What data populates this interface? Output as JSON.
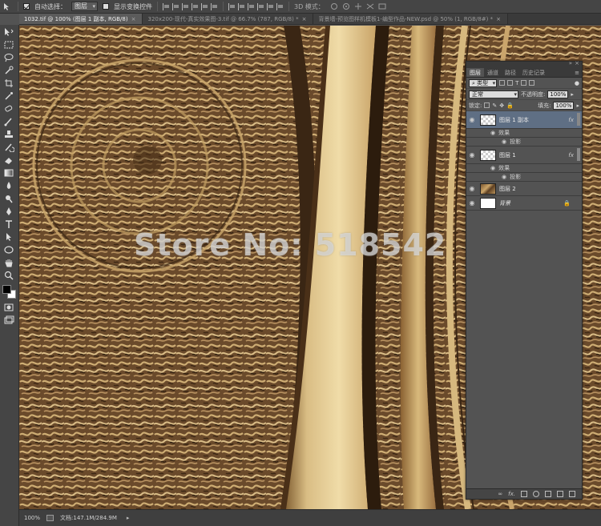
{
  "options_bar": {
    "auto_select_label": "自动选择：",
    "auto_select_value": "图层",
    "show_transform_label": "显示变换控件",
    "mode_3d_label": "3D 模式："
  },
  "tabs": [
    {
      "label": "1032.tif @ 100% (图层 1 副本, RGB/8)",
      "close": "×"
    },
    {
      "label": "320x200-现代-真实效果图-3.tif @ 66.7% (787, RGB/8) *",
      "close": "×"
    },
    {
      "label": "背景墙-预览图样机模板1-编型作品-NEW.psd @ 50% (1, RGB/8#) *",
      "close": "×"
    }
  ],
  "watermark": "Store No: 518542",
  "status_bar": {
    "zoom": "100%",
    "doc_info": "文档:147.1M/284.9M",
    "arrow": "▸"
  },
  "layers_panel": {
    "tabs": [
      "图层",
      "通道",
      "路径",
      "历史记录"
    ],
    "menu_icon": "≡",
    "filter_label": "类型",
    "blend_mode": "正常",
    "opacity_label": "不透明度:",
    "opacity_value": "100%",
    "lock_label": "锁定:",
    "fill_label": "填充:",
    "fill_value": "100%",
    "layers": [
      {
        "name": "图层 1 副本",
        "effects_label": "效果",
        "effect": "投影",
        "fx": "fx"
      },
      {
        "name": "图层 1",
        "effects_label": "效果",
        "effect": "投影",
        "fx": "fx"
      },
      {
        "name": "图层 2"
      },
      {
        "name": "背景",
        "lock": "🔒"
      }
    ],
    "footer": {
      "link": "∞",
      "fx": "fx."
    }
  },
  "colors": {
    "panel_bg": "#535353",
    "selected_layer": "#5f6f84",
    "foreground": "#000000",
    "background": "#ffffff"
  },
  "icons": [
    "move-icon",
    "marquee-icon",
    "lasso-icon",
    "quick-select-icon",
    "crop-icon",
    "eyedropper-icon",
    "healing-icon",
    "brush-icon",
    "stamp-icon",
    "history-brush-icon",
    "eraser-icon",
    "gradient-icon",
    "blur-icon",
    "dodge-icon",
    "pen-icon",
    "type-icon",
    "path-select-icon",
    "shape-icon",
    "hand-icon",
    "zoom-icon"
  ]
}
